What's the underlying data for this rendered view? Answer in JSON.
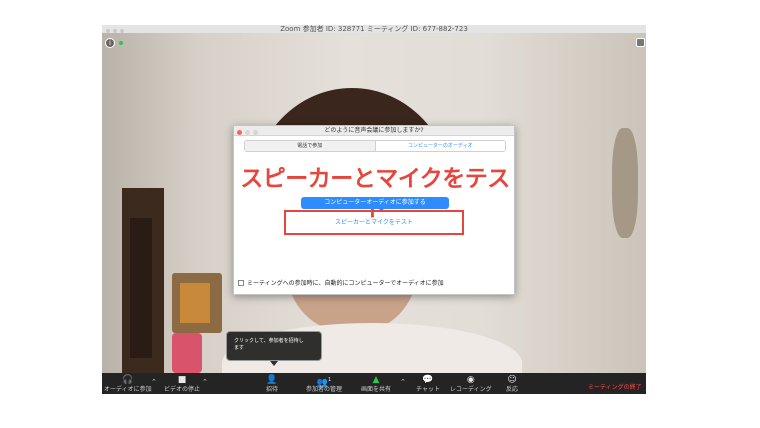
{
  "window": {
    "title": "Zoom 参加者 ID: 328771   ミーティング ID: 677-882-723"
  },
  "video": {
    "info_icon": "info-icon",
    "mic_status_color": "#2cc84a",
    "sign_text": "ミーティングの終了"
  },
  "dialog": {
    "title": "どのように音声会議に参加しますか?",
    "tabs": [
      {
        "label": "電話で参加",
        "selected": false
      },
      {
        "label": "コンピューターのオーディオ",
        "selected": true
      }
    ],
    "overlay_heading": "スピーカーとマイクをテスト",
    "join_button": "コンピューターオーディオに参加する",
    "test_link": "スピーカーとマイクをテスト",
    "auto_join_label": "ミーティングへの参加時に、自動的にコンピューターでオーディオに参加",
    "accent_color": "#2d8cff",
    "highlight_color": "#e8453c"
  },
  "tooltip": {
    "line1": "クリックして、参加者を招待し",
    "line2": "ます"
  },
  "toolbar": {
    "audio": {
      "icon": "headphones-icon",
      "label": "オーディオに参加"
    },
    "video": {
      "icon": "camera-icon",
      "label": "ビデオの停止"
    },
    "invite": {
      "icon": "add-user-icon",
      "label": "招待"
    },
    "participants": {
      "icon": "participants-icon",
      "count": "1",
      "label": "参加者の管理"
    },
    "share": {
      "icon": "share-screen-icon",
      "label": "画面を共有"
    },
    "chat": {
      "icon": "chat-icon",
      "label": "チャット"
    },
    "record": {
      "icon": "record-icon",
      "label": "レコーディング"
    },
    "reactions": {
      "icon": "reaction-icon",
      "label": "反応"
    },
    "leave": "ミーティングの終了"
  }
}
